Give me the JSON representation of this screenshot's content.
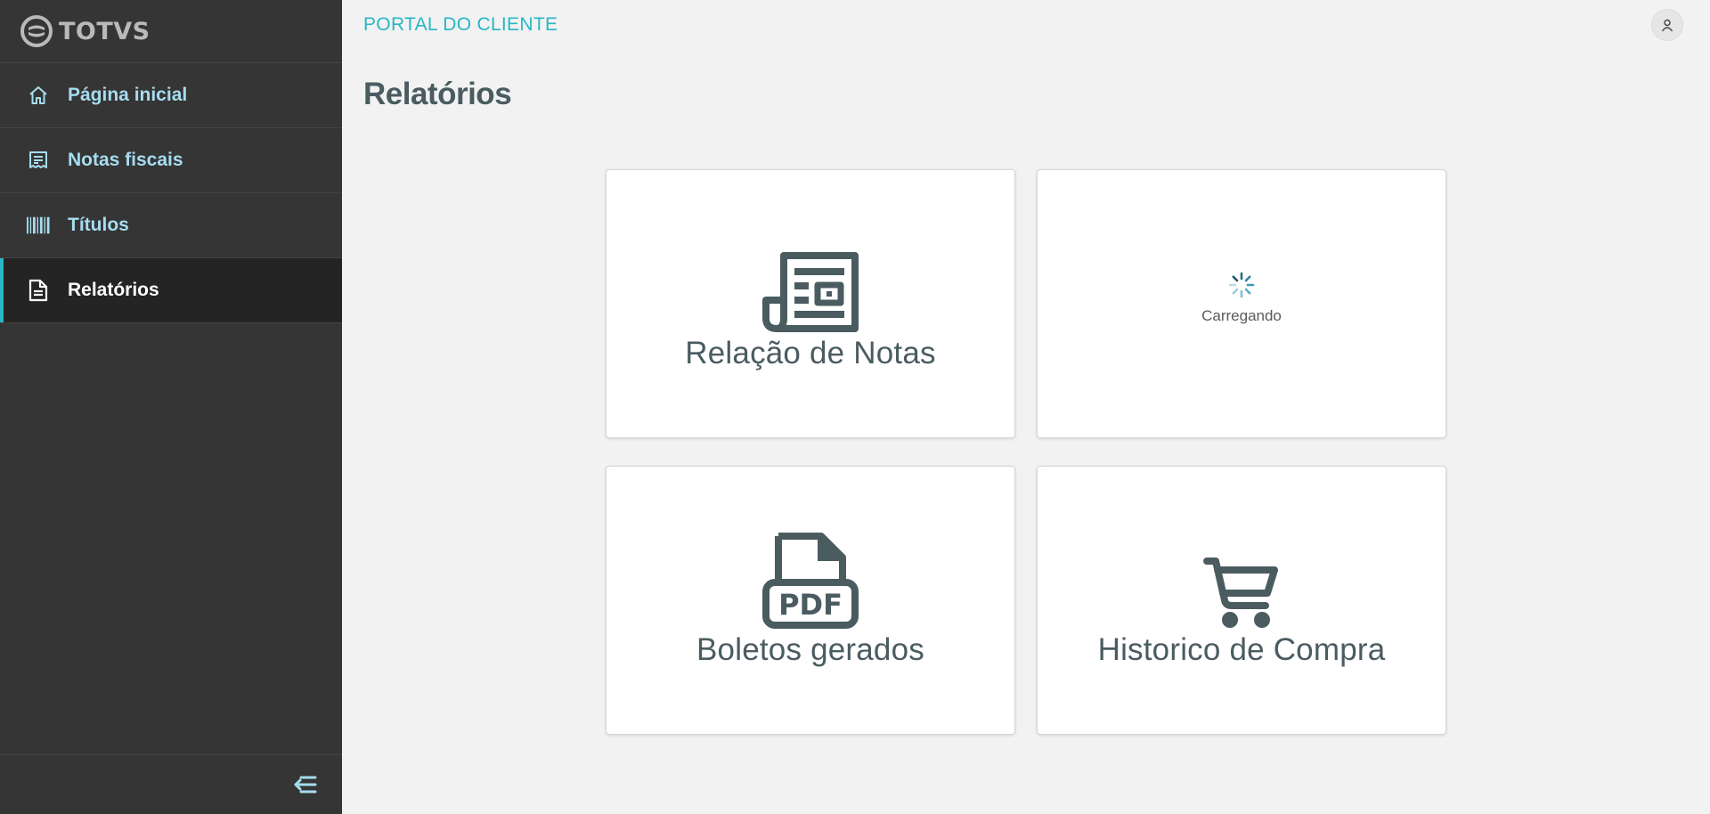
{
  "brand": {
    "logo_text": "TOTVS"
  },
  "sidebar": {
    "items": [
      {
        "label": "Página inicial",
        "icon": "home-icon",
        "active": false
      },
      {
        "label": "Notas fiscais",
        "icon": "receipt-icon",
        "active": false
      },
      {
        "label": "Títulos",
        "icon": "barcode-icon",
        "active": false
      },
      {
        "label": "Relatórios",
        "icon": "document-icon",
        "active": true
      }
    ]
  },
  "header": {
    "portal_title": "PORTAL DO CLIENTE"
  },
  "main": {
    "page_title": "Relatórios",
    "cards": [
      {
        "label": "Relação de Notas",
        "icon": "newspaper-icon"
      },
      {
        "loading_label": "Carregando",
        "icon": "spinner-icon"
      },
      {
        "label": "Boletos gerados",
        "icon": "pdf-file-icon"
      },
      {
        "label": "Historico de Compra",
        "icon": "shopping-cart-icon"
      }
    ]
  },
  "colors": {
    "accent": "#29b6c5",
    "sidebar_bg": "#353535",
    "sidebar_active_bg": "#242424",
    "nav_text": "#a6dcef",
    "card_text": "#4a5c60"
  }
}
